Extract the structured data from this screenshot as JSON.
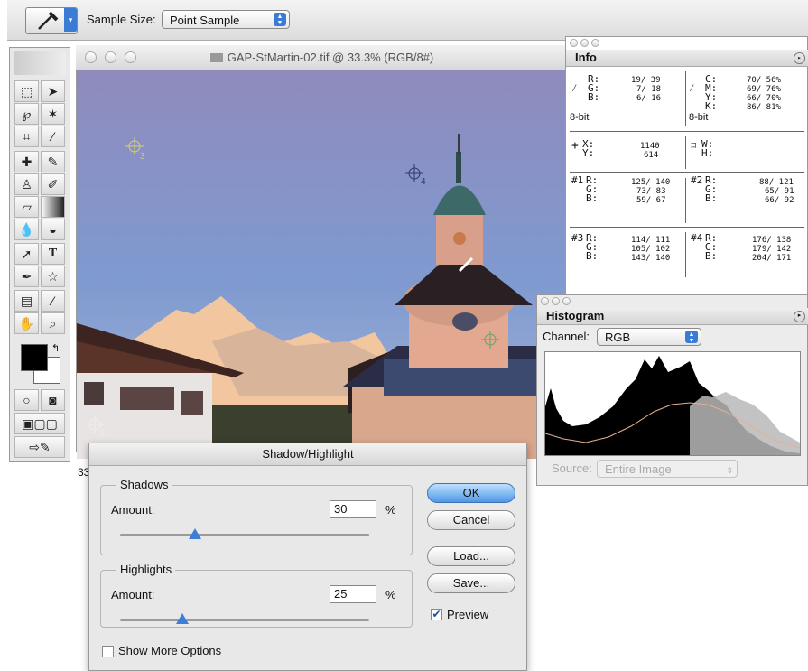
{
  "options_bar": {
    "sample_size_label": "Sample Size:",
    "sample_size_value": "Point Sample"
  },
  "document": {
    "title": "GAP-StMartin-02.tif @ 33.3% (RGB/8#)",
    "zoom_label": "33"
  },
  "samplers": [
    "3",
    "4",
    "2"
  ],
  "info": {
    "tab": "Info",
    "rgb": {
      "r": "19/ 39",
      "g": "7/ 18",
      "b": "6/ 16",
      "depth": "8-bit"
    },
    "cmyk": {
      "c": "70/ 56%",
      "m": "69/ 76%",
      "y": "66/ 70%",
      "k": "86/ 81%",
      "depth": "8-bit"
    },
    "xy": {
      "x": "1140",
      "y": "614"
    },
    "wh": {
      "w": "",
      "h": ""
    },
    "s1": {
      "label": "#1",
      "r": "125/ 140",
      "g": "73/ 83",
      "b": "59/ 67"
    },
    "s2": {
      "label": "#2",
      "r": "88/ 121",
      "g": "65/ 91",
      "b": "66/ 92"
    },
    "s3": {
      "label": "#3",
      "r": "114/ 111",
      "g": "105/ 102",
      "b": "143/ 140"
    },
    "s4": {
      "label": "#4",
      "r": "176/ 138",
      "g": "179/ 142",
      "b": "204/ 171"
    }
  },
  "histogram": {
    "tab": "Histogram",
    "channel_label": "Channel:",
    "channel_value": "RGB",
    "source_label": "Source:",
    "source_value": "Entire Image"
  },
  "dialog": {
    "title": "Shadow/Highlight",
    "shadows": {
      "label": "Shadows",
      "amount_label": "Amount:",
      "amount": "30",
      "unit": "%",
      "slider_pct": 30
    },
    "highlights": {
      "label": "Highlights",
      "amount_label": "Amount:",
      "amount": "25",
      "unit": "%",
      "slider_pct": 25
    },
    "ok": "OK",
    "cancel": "Cancel",
    "load": "Load...",
    "save": "Save...",
    "preview_label": "Preview",
    "preview_checked": true,
    "more_options_label": "Show More Options",
    "more_options_checked": false
  }
}
